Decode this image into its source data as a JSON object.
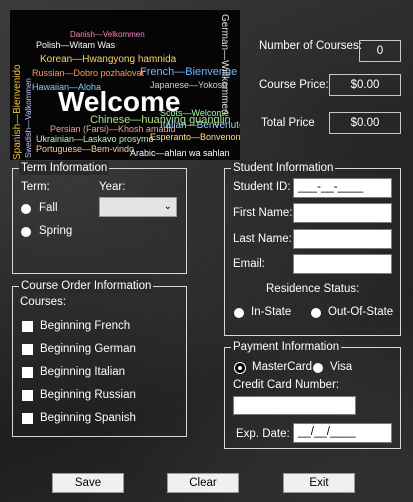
{
  "banner": {
    "big_word": "Welcome",
    "words": [
      "Spanish—Bienvenido",
      "French—Bienvenue",
      "Chinese—huanying guanglin",
      "German—Willkommen",
      "Korean—Hwangyong hamnida",
      "Russian—Dobro pozhalovat'",
      "Polish—Witam Was",
      "Hawaiian—Aloha",
      "Japanese—Yokoso",
      "Italian—Benvenuto",
      "Esperanto—Bonvenon",
      "Persian (Farsi)—Khosh amadid",
      "Ukrainian—Laskavo prosymo",
      "Portuguese—Bem-vindo",
      "Arabic—ahlan wa sahlan",
      "Scots—Welcome",
      "Swedish—Valkommen",
      "Danish—Velkommen"
    ]
  },
  "summary": {
    "courses_label": "Number of Courses:",
    "courses_value": "0",
    "price_label": "Course Price:",
    "price_value": "$0.00",
    "total_label": "Total Price",
    "total_value": "$0.00"
  },
  "term": {
    "legend": "Term Information",
    "term_label": "Term:",
    "year_label": "Year:",
    "fall": "Fall",
    "spring": "Spring"
  },
  "courses": {
    "legend": "Course Order Information",
    "label": "Courses:",
    "items": [
      "Beginning French",
      "Beginning German",
      "Beginning Italian",
      "Beginning Russian",
      "Beginning Spanish"
    ]
  },
  "student": {
    "legend": "Student Information",
    "id_label": "Student ID:",
    "id_mask": "___-__-____",
    "first_label": "First Name:",
    "last_label": "Last Name:",
    "email_label": "Email:",
    "residence_label": "Residence Status:",
    "instate": "In-State",
    "outofstate": "Out-Of-State"
  },
  "payment": {
    "legend": "Payment Information",
    "mastercard": "MasterCard",
    "visa": "Visa",
    "card_label": "Credit Card Number:",
    "exp_label": "Exp. Date:",
    "exp_mask": "__/__/____"
  },
  "buttons": {
    "save": "Save",
    "clear": "Clear",
    "exit": "Exit"
  }
}
